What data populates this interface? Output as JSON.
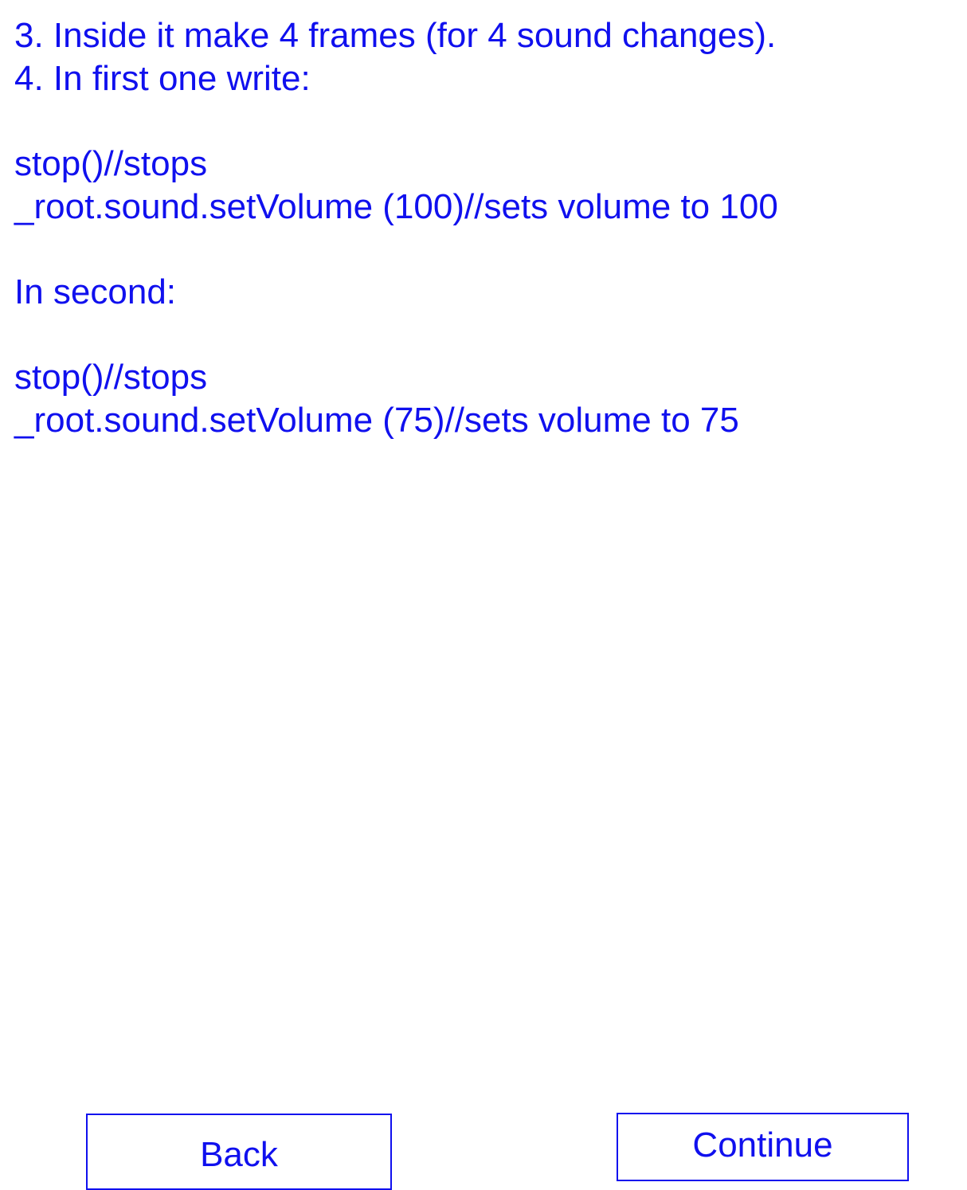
{
  "colors": {
    "text": "#1010ee",
    "border": "#1010ee",
    "background": "#ffffff"
  },
  "content": {
    "lines": [
      "3. Inside it make 4 frames (for 4 sound changes).",
      "4. In first one write:",
      "",
      "stop()//stops",
      "_root.sound.setVolume (100)//sets volume to 100",
      "",
      "In second:",
      "",
      "stop()//stops",
      "_root.sound.setVolume (75)//sets volume to 75"
    ]
  },
  "buttons": {
    "back_label": "Back",
    "continue_label": "Continue"
  }
}
